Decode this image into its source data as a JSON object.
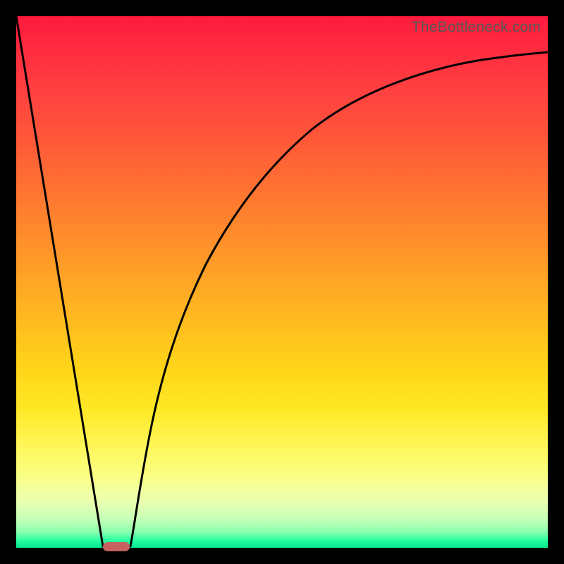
{
  "watermark": "TheBottleneck.com",
  "colors": {
    "frame": "#000000",
    "marker": "#c7605e",
    "curve_stroke": "#000000"
  },
  "chart_data": {
    "type": "line",
    "title": "",
    "xlabel": "",
    "ylabel": "",
    "xlim": [
      0,
      100
    ],
    "ylim": [
      0,
      100
    ],
    "series": [
      {
        "name": "left-line",
        "x": [
          0,
          16.3
        ],
        "y": [
          100,
          0
        ]
      },
      {
        "name": "right-curve",
        "x": [
          21.5,
          23,
          25,
          27,
          30,
          34,
          38,
          43,
          50,
          58,
          68,
          80,
          90,
          100
        ],
        "y": [
          0,
          7,
          18,
          28,
          40,
          52,
          60.5,
          68,
          74.5,
          79.8,
          84,
          87.3,
          89.2,
          90.8
        ]
      }
    ],
    "marker": {
      "x_center_pct": 18.9,
      "y_pct": 0,
      "width_pct": 5.0
    },
    "gradient_stops": [
      {
        "pct": 0,
        "color": "#ff1a3e"
      },
      {
        "pct": 50,
        "color": "#ffb020"
      },
      {
        "pct": 82,
        "color": "#fff560"
      },
      {
        "pct": 100,
        "color": "#00e890"
      }
    ]
  }
}
